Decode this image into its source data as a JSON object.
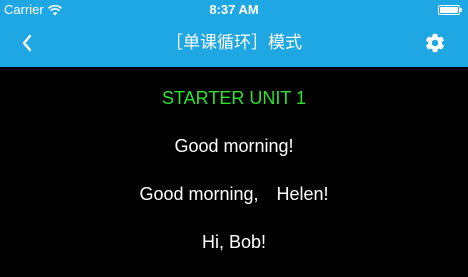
{
  "status_bar": {
    "carrier": "Carrier",
    "time": "8:37 AM",
    "wifi_icon": "wifi-icon",
    "battery_icon": "battery-icon"
  },
  "nav": {
    "title": "［单课循环］模式",
    "back_icon": "chevron-left-icon",
    "settings_icon": "gear-icon"
  },
  "content": {
    "lines": [
      "STARTER UNIT 1",
      "Good morning!",
      "Good morning,　Helen!",
      "Hi, Bob!"
    ]
  },
  "colors": {
    "nav_background": "#1fa7e3",
    "content_background": "#000000",
    "heading_green": "#2ee22e",
    "text_white": "#ffffff"
  }
}
